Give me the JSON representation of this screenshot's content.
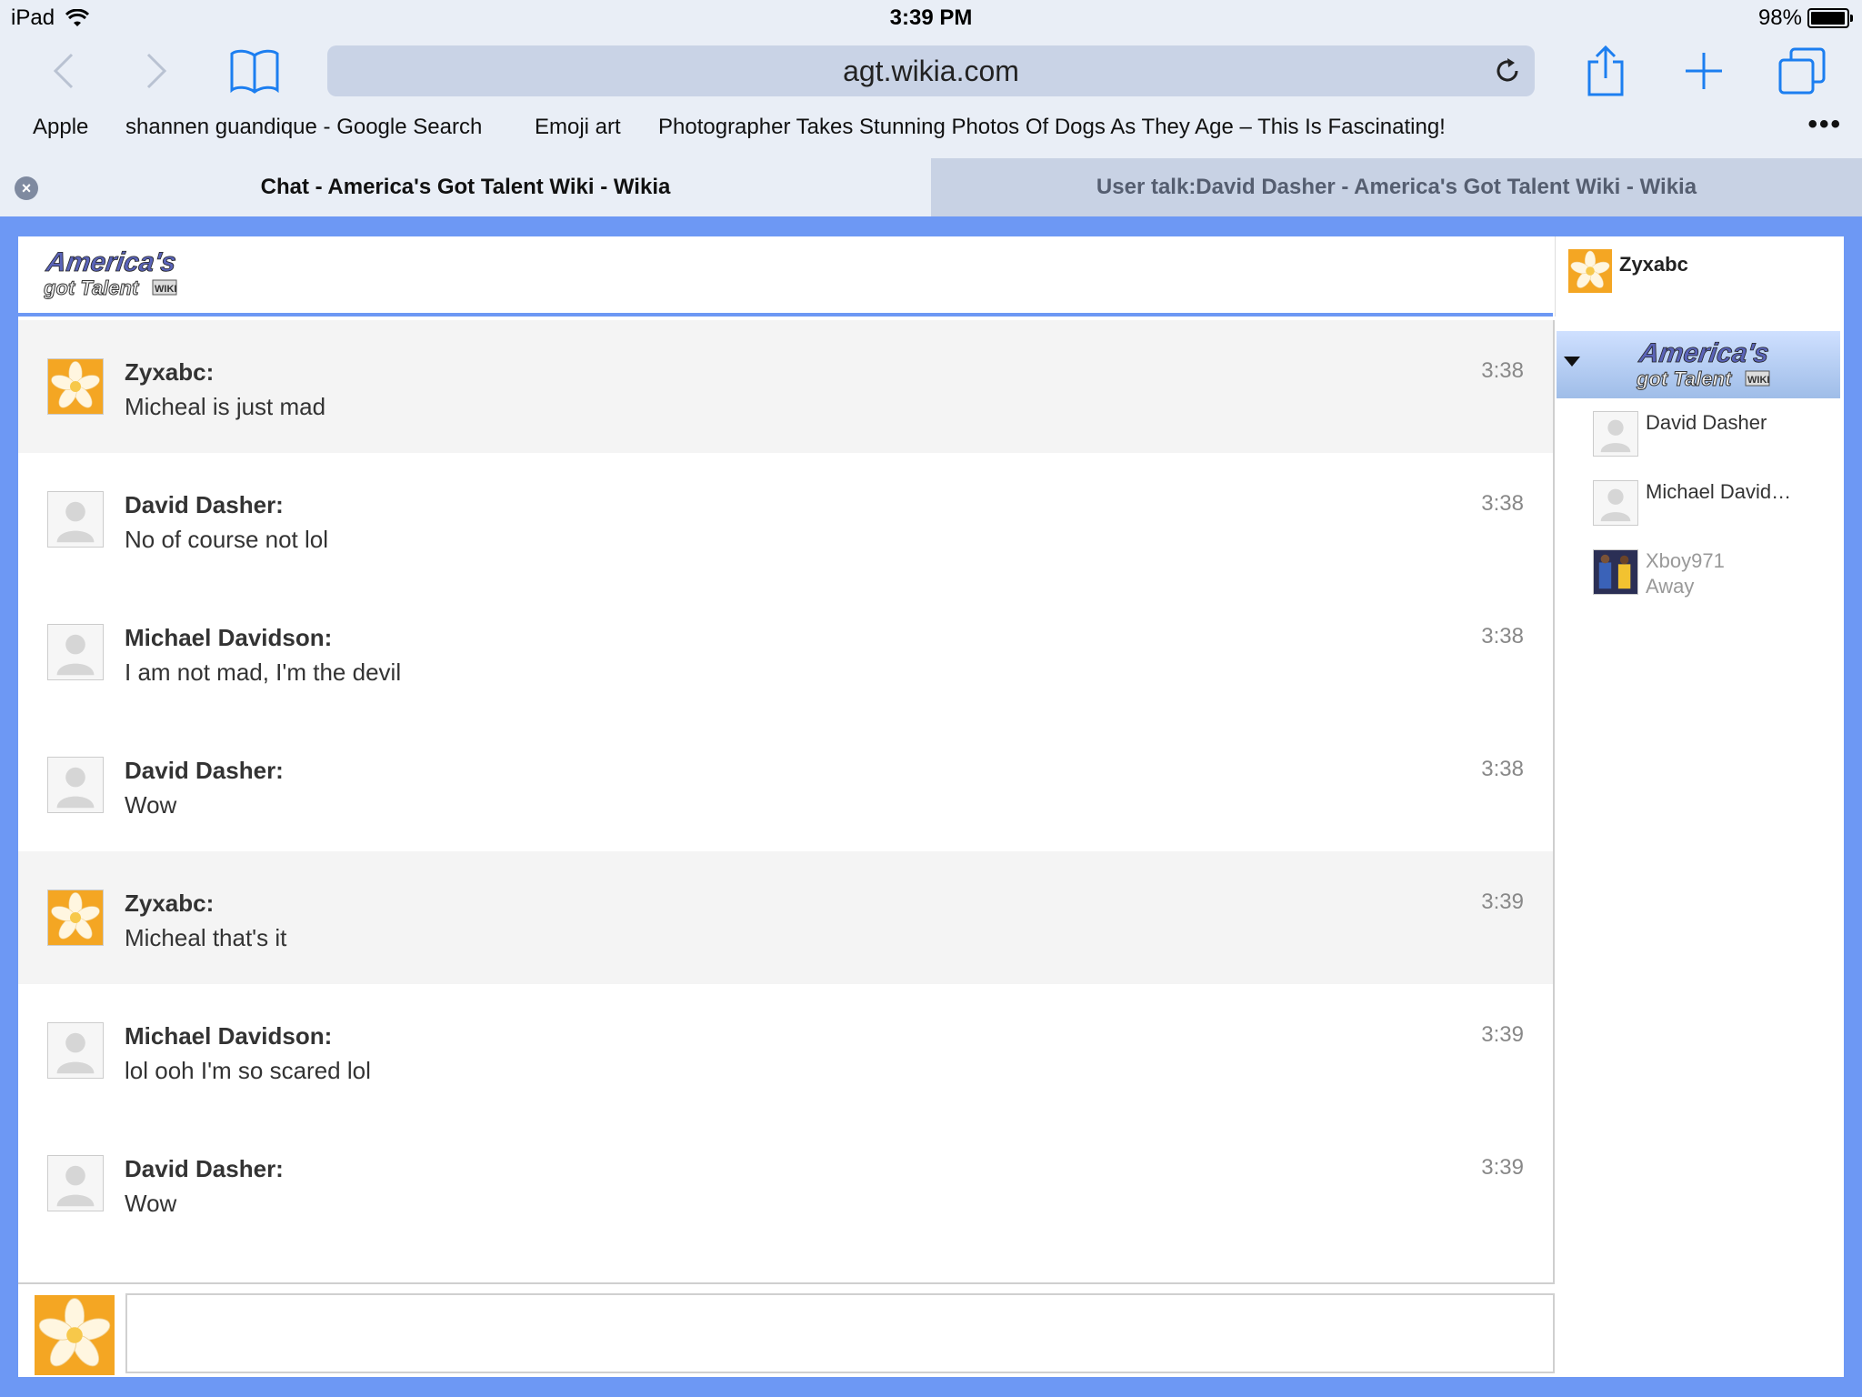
{
  "status": {
    "device": "iPad",
    "time": "3:39 PM",
    "battery_pct": "98%",
    "battery_level": 0.98
  },
  "toolbar": {
    "url": "agt.wikia.com"
  },
  "bookmarks": [
    "Apple",
    "shannen guandique - Google Search",
    "Emoji art",
    "Photographer Takes Stunning Photos Of Dogs As They Age – This Is Fascinating!"
  ],
  "tabs": [
    {
      "title": "Chat - America's Got Talent Wiki - Wikia",
      "active": true
    },
    {
      "title": "User talk:David Dasher - America's Got Talent Wiki - Wikia",
      "active": false
    }
  ],
  "chat": {
    "self_user": "Zyxabc",
    "messages": [
      {
        "author": "Zyxabc:",
        "text": "Micheal is just mad",
        "time": "3:38",
        "avatar": "flower"
      },
      {
        "author": "David Dasher:",
        "text": "No of course not lol",
        "time": "3:38",
        "avatar": "default"
      },
      {
        "author": "Michael Davidson:",
        "text": "I am not mad, I'm the devil",
        "time": "3:38",
        "avatar": "default"
      },
      {
        "author": "David Dasher:",
        "text": "Wow",
        "time": "3:38",
        "avatar": "default"
      },
      {
        "author": "Zyxabc:",
        "text": "Micheal that's it",
        "time": "3:39",
        "avatar": "flower"
      },
      {
        "author": "Michael Davidson:",
        "text": "lol ooh I'm so scared lol",
        "time": "3:39",
        "avatar": "default"
      },
      {
        "author": "David Dasher:",
        "text": "Wow",
        "time": "3:39",
        "avatar": "default"
      }
    ],
    "users": [
      {
        "name": "David Dasher",
        "status": "",
        "avatar": "default"
      },
      {
        "name": "Michael David…",
        "status": "",
        "avatar": "default"
      },
      {
        "name": "Xboy971",
        "status": "Away",
        "avatar": "photo"
      }
    ]
  }
}
